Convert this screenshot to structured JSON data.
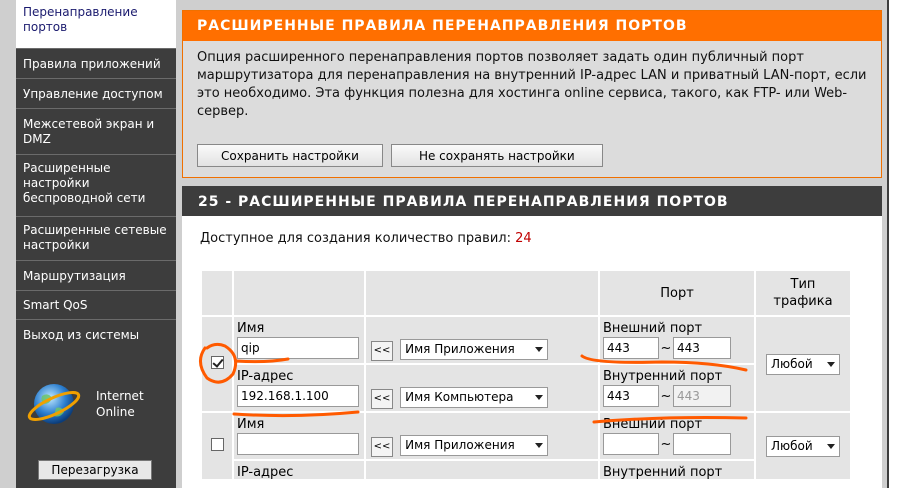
{
  "sidebar": {
    "items": [
      {
        "label": "Перенаправление портов",
        "active": true
      },
      {
        "label": "Правила приложений"
      },
      {
        "label": "Управление доступом"
      },
      {
        "label": "Межсетевой экран и DMZ"
      },
      {
        "label": "Расширенные настройки беспроводной сети"
      },
      {
        "label": "Расширенные сетевые настройки"
      },
      {
        "label": "Маршрутизация"
      },
      {
        "label": "Smart QoS"
      },
      {
        "label": "Выход из системы"
      }
    ],
    "internet_status_line1": "Internet",
    "internet_status_line2": "Online",
    "reboot_label": "Перезагрузка"
  },
  "top_panel": {
    "title": "РАСШИРЕННЫЕ ПРАВИЛА ПЕРЕНАПРАВЛЕНИЯ ПОРТОВ",
    "description": "Опция расширенного перенаправления портов позволяет задать один публичный порт маршрутизатора для перенаправления на внутренний IP-адрес LAN и приватный LAN-порт, если это необходимо. Эта функция полезна для хостинга online сервиса, такого, как FTP- или Web-сервер.",
    "save_label": "Сохранить настройки",
    "nosave_label": "Не сохранять настройки"
  },
  "rules_panel": {
    "title": "25 - РАСШИРЕННЫЕ ПРАВИЛА ПЕРЕНАПРАВЛЕНИЯ ПОРТОВ",
    "count_label": "Доступное для создания количество правил:",
    "count_value": "24",
    "columns": {
      "port": "Порт",
      "traffic_line1": "Тип",
      "traffic_line2": "трафика"
    },
    "labels": {
      "name": "Имя",
      "ip": "IP-адрес",
      "external_port": "Внешний порт",
      "internal_port": "Внутренний порт",
      "tilde": "~",
      "arrow": "<<"
    },
    "rows": [
      {
        "checked": true,
        "name": "qip",
        "ip": "192.168.1.100",
        "app_select": "Имя Приложения",
        "pc_select": "Имя Компьютера",
        "ext_from": "443",
        "ext_to": "443",
        "int_from": "443",
        "int_to": "443",
        "traffic": "Любой"
      },
      {
        "checked": false,
        "name": "",
        "ip": "",
        "app_select": "Имя Приложения",
        "ext_from": "",
        "ext_to": "",
        "traffic": "Любой"
      }
    ],
    "row2_ip_label": "IP-адрес",
    "row2_int_label": "Внутренний порт"
  },
  "colors": {
    "accent_orange": "#ff6f00",
    "sidebar_bg": "#3d3d3d",
    "annotation": "#ff5a00"
  }
}
